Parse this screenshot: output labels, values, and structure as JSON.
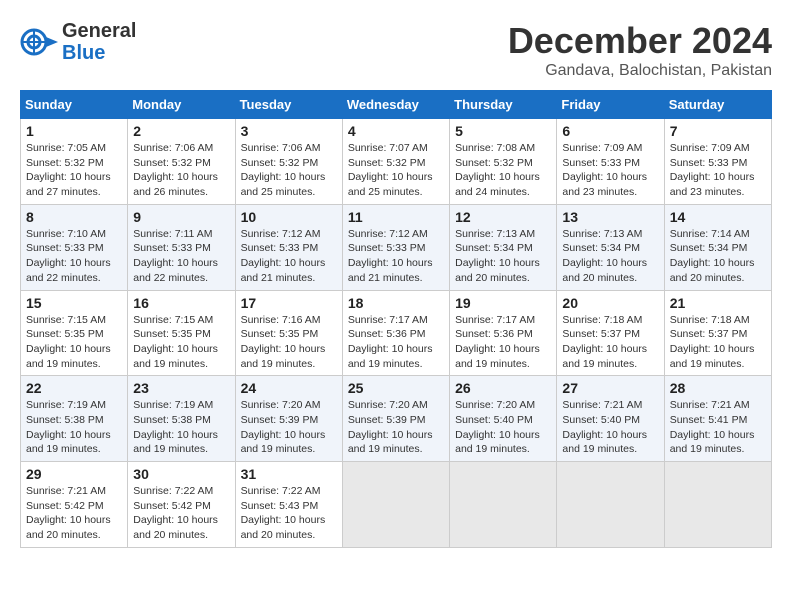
{
  "header": {
    "logo_line1": "General",
    "logo_line2": "Blue",
    "month": "December 2024",
    "location": "Gandava, Balochistan, Pakistan"
  },
  "weekdays": [
    "Sunday",
    "Monday",
    "Tuesday",
    "Wednesday",
    "Thursday",
    "Friday",
    "Saturday"
  ],
  "weeks": [
    [
      {
        "day": "1",
        "sunrise": "7:05 AM",
        "sunset": "5:32 PM",
        "daylight": "10 hours and 27 minutes."
      },
      {
        "day": "2",
        "sunrise": "7:06 AM",
        "sunset": "5:32 PM",
        "daylight": "10 hours and 26 minutes."
      },
      {
        "day": "3",
        "sunrise": "7:06 AM",
        "sunset": "5:32 PM",
        "daylight": "10 hours and 25 minutes."
      },
      {
        "day": "4",
        "sunrise": "7:07 AM",
        "sunset": "5:32 PM",
        "daylight": "10 hours and 25 minutes."
      },
      {
        "day": "5",
        "sunrise": "7:08 AM",
        "sunset": "5:32 PM",
        "daylight": "10 hours and 24 minutes."
      },
      {
        "day": "6",
        "sunrise": "7:09 AM",
        "sunset": "5:33 PM",
        "daylight": "10 hours and 23 minutes."
      },
      {
        "day": "7",
        "sunrise": "7:09 AM",
        "sunset": "5:33 PM",
        "daylight": "10 hours and 23 minutes."
      }
    ],
    [
      {
        "day": "8",
        "sunrise": "7:10 AM",
        "sunset": "5:33 PM",
        "daylight": "10 hours and 22 minutes."
      },
      {
        "day": "9",
        "sunrise": "7:11 AM",
        "sunset": "5:33 PM",
        "daylight": "10 hours and 22 minutes."
      },
      {
        "day": "10",
        "sunrise": "7:12 AM",
        "sunset": "5:33 PM",
        "daylight": "10 hours and 21 minutes."
      },
      {
        "day": "11",
        "sunrise": "7:12 AM",
        "sunset": "5:33 PM",
        "daylight": "10 hours and 21 minutes."
      },
      {
        "day": "12",
        "sunrise": "7:13 AM",
        "sunset": "5:34 PM",
        "daylight": "10 hours and 20 minutes."
      },
      {
        "day": "13",
        "sunrise": "7:13 AM",
        "sunset": "5:34 PM",
        "daylight": "10 hours and 20 minutes."
      },
      {
        "day": "14",
        "sunrise": "7:14 AM",
        "sunset": "5:34 PM",
        "daylight": "10 hours and 20 minutes."
      }
    ],
    [
      {
        "day": "15",
        "sunrise": "7:15 AM",
        "sunset": "5:35 PM",
        "daylight": "10 hours and 19 minutes."
      },
      {
        "day": "16",
        "sunrise": "7:15 AM",
        "sunset": "5:35 PM",
        "daylight": "10 hours and 19 minutes."
      },
      {
        "day": "17",
        "sunrise": "7:16 AM",
        "sunset": "5:35 PM",
        "daylight": "10 hours and 19 minutes."
      },
      {
        "day": "18",
        "sunrise": "7:17 AM",
        "sunset": "5:36 PM",
        "daylight": "10 hours and 19 minutes."
      },
      {
        "day": "19",
        "sunrise": "7:17 AM",
        "sunset": "5:36 PM",
        "daylight": "10 hours and 19 minutes."
      },
      {
        "day": "20",
        "sunrise": "7:18 AM",
        "sunset": "5:37 PM",
        "daylight": "10 hours and 19 minutes."
      },
      {
        "day": "21",
        "sunrise": "7:18 AM",
        "sunset": "5:37 PM",
        "daylight": "10 hours and 19 minutes."
      }
    ],
    [
      {
        "day": "22",
        "sunrise": "7:19 AM",
        "sunset": "5:38 PM",
        "daylight": "10 hours and 19 minutes."
      },
      {
        "day": "23",
        "sunrise": "7:19 AM",
        "sunset": "5:38 PM",
        "daylight": "10 hours and 19 minutes."
      },
      {
        "day": "24",
        "sunrise": "7:20 AM",
        "sunset": "5:39 PM",
        "daylight": "10 hours and 19 minutes."
      },
      {
        "day": "25",
        "sunrise": "7:20 AM",
        "sunset": "5:39 PM",
        "daylight": "10 hours and 19 minutes."
      },
      {
        "day": "26",
        "sunrise": "7:20 AM",
        "sunset": "5:40 PM",
        "daylight": "10 hours and 19 minutes."
      },
      {
        "day": "27",
        "sunrise": "7:21 AM",
        "sunset": "5:40 PM",
        "daylight": "10 hours and 19 minutes."
      },
      {
        "day": "28",
        "sunrise": "7:21 AM",
        "sunset": "5:41 PM",
        "daylight": "10 hours and 19 minutes."
      }
    ],
    [
      {
        "day": "29",
        "sunrise": "7:21 AM",
        "sunset": "5:42 PM",
        "daylight": "10 hours and 20 minutes."
      },
      {
        "day": "30",
        "sunrise": "7:22 AM",
        "sunset": "5:42 PM",
        "daylight": "10 hours and 20 minutes."
      },
      {
        "day": "31",
        "sunrise": "7:22 AM",
        "sunset": "5:43 PM",
        "daylight": "10 hours and 20 minutes."
      },
      null,
      null,
      null,
      null
    ]
  ]
}
